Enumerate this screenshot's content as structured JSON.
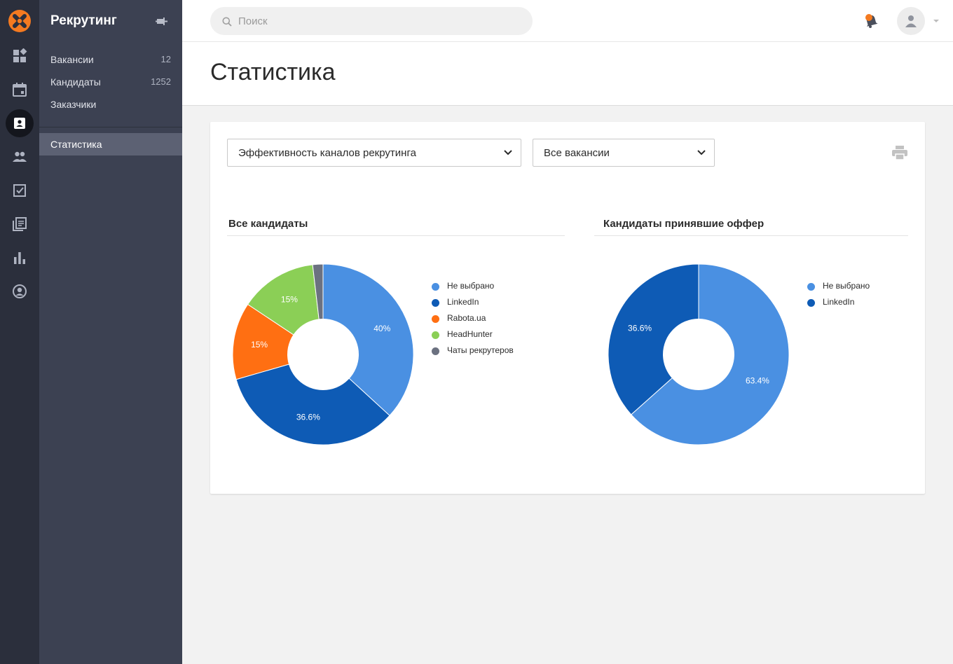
{
  "app": {
    "section_title": "Рекрутинг"
  },
  "sidebar": {
    "items": [
      {
        "label": "Вакансии",
        "count": "12"
      },
      {
        "label": "Кандидаты",
        "count": "1252"
      },
      {
        "label": "Заказчики",
        "count": ""
      }
    ],
    "active_item": "Статистика"
  },
  "rail_icons": [
    "dashboard-icon",
    "calendar-icon",
    "contact-card-icon",
    "people-icon",
    "tasks-icon",
    "library-icon",
    "bar-chart-icon",
    "account-circle-icon"
  ],
  "search": {
    "placeholder": "Поиск"
  },
  "page": {
    "title": "Статистика"
  },
  "filters": {
    "report": "Эффективность каналов рекрутинга",
    "vacancy": "Все вакансии"
  },
  "colors": {
    "accent": "#f47a20",
    "not_selected": "#4a90e2",
    "linkedin": "#0e5bb5",
    "rabota": "#ff6f12",
    "headhunter": "#8bcf56",
    "chats": "#6b7180"
  },
  "chart_data": [
    {
      "type": "pie",
      "title": "Все кандидаты",
      "series": [
        {
          "name": "Не выбрано",
          "value": 40,
          "label": "40%",
          "color": "#4a90e2"
        },
        {
          "name": "LinkedIn",
          "value": 36.6,
          "label": "36.6%",
          "color": "#0e5bb5"
        },
        {
          "name": "Rabota.ua",
          "value": 15,
          "label": "15%",
          "color": "#ff6f12"
        },
        {
          "name": "HeadHunter",
          "value": 15,
          "label": "15%",
          "color": "#8bcf56"
        },
        {
          "name": "Чаты рекрутеров",
          "value": 2,
          "label": "",
          "color": "#6b7180"
        }
      ],
      "legend": "right"
    },
    {
      "type": "pie",
      "title": "Кандидаты принявшие оффер",
      "series": [
        {
          "name": "Не выбрано",
          "value": 63.4,
          "label": "63.4%",
          "color": "#4a90e2"
        },
        {
          "name": "LinkedIn",
          "value": 36.6,
          "label": "36.6%",
          "color": "#0e5bb5"
        }
      ],
      "legend": "right"
    }
  ]
}
